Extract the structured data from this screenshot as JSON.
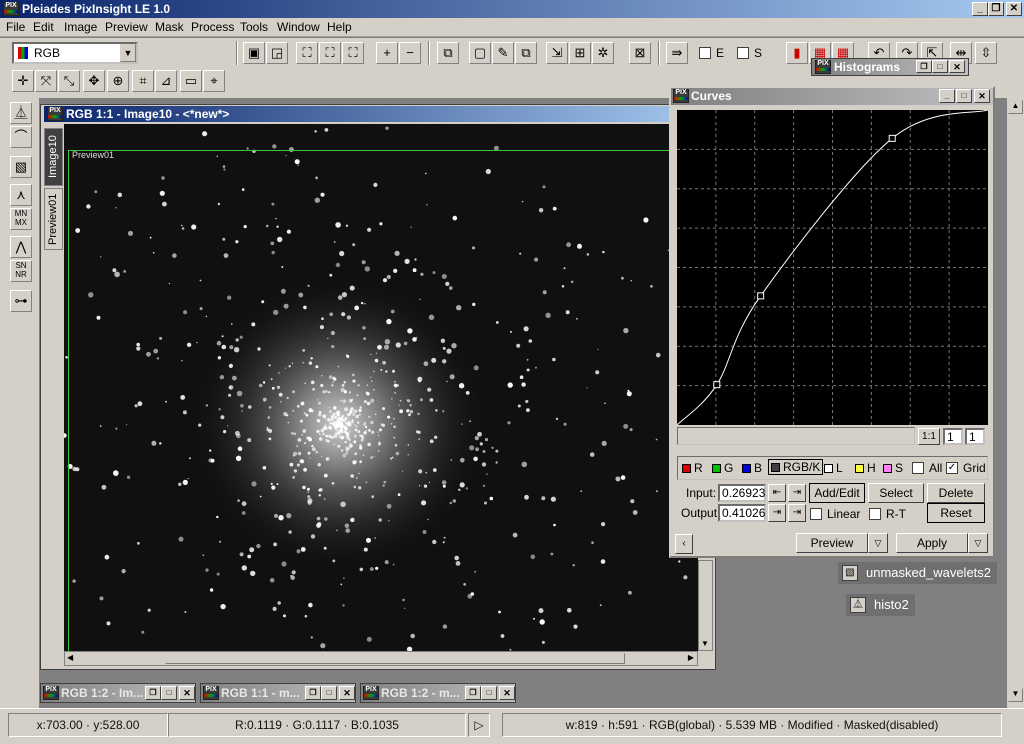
{
  "app": {
    "title": "Pleiades PixInsight LE 1.0"
  },
  "menu": [
    "File",
    "Edit",
    "Image",
    "Preview",
    "Mask",
    "Process",
    "Tools",
    "Window",
    "Help"
  ],
  "toolbar": {
    "color_space": "RGB",
    "check_e": "E",
    "check_s": "S"
  },
  "image_window": {
    "title": "RGB 1:1 - Image10 - <*new*>",
    "tab_image": "Image10",
    "tab_preview": "Preview01",
    "preview_label": "Preview01"
  },
  "histograms": {
    "title": "Histograms"
  },
  "curves": {
    "title": "Curves",
    "zoom_label": "1:1",
    "zoom_x": "1",
    "zoom_y": "1",
    "channels": [
      {
        "label": "R",
        "color": "#e00000"
      },
      {
        "label": "G",
        "color": "#00c000"
      },
      {
        "label": "B",
        "color": "#0000e0"
      },
      {
        "label": "RGB/K",
        "color": "#404040"
      },
      {
        "label": "L",
        "color": "#ffffff"
      },
      {
        "label": "H",
        "color": "#ffff40"
      },
      {
        "label": "S",
        "color": "#ff80ff"
      }
    ],
    "all_label": "All",
    "grid_label": "Grid",
    "input_label": "Input:",
    "input_value": "0.26923",
    "output_label": "Output:",
    "output_value": "0.41026",
    "add_edit": "Add/Edit",
    "select": "Select",
    "delete": "Delete",
    "linear": "Linear",
    "rt": "R-T",
    "reset": "Reset",
    "preview": "Preview",
    "apply": "Apply",
    "points": [
      [
        0,
        0
      ],
      [
        0.128,
        0.128
      ],
      [
        0.269,
        0.41
      ],
      [
        0.692,
        0.91
      ],
      [
        1,
        1
      ]
    ]
  },
  "icons": [
    {
      "label": "unmasked_wavelets2",
      "icon": "wavelets-icon"
    },
    {
      "label": "histo2",
      "icon": "histogram-icon"
    }
  ],
  "minimized": [
    "RGB 1:2 - Im...",
    "RGB 1:1 - m...",
    "RGB 1:2 - m..."
  ],
  "status": {
    "coords": "x:703.00 · y:528.00",
    "rgb": "R:0.1119 · G:0.1117 · B:0.1035",
    "info": "w:819 · h:591 · RGB(global) · 5.539 MB · Modified · Masked(disabled)"
  }
}
